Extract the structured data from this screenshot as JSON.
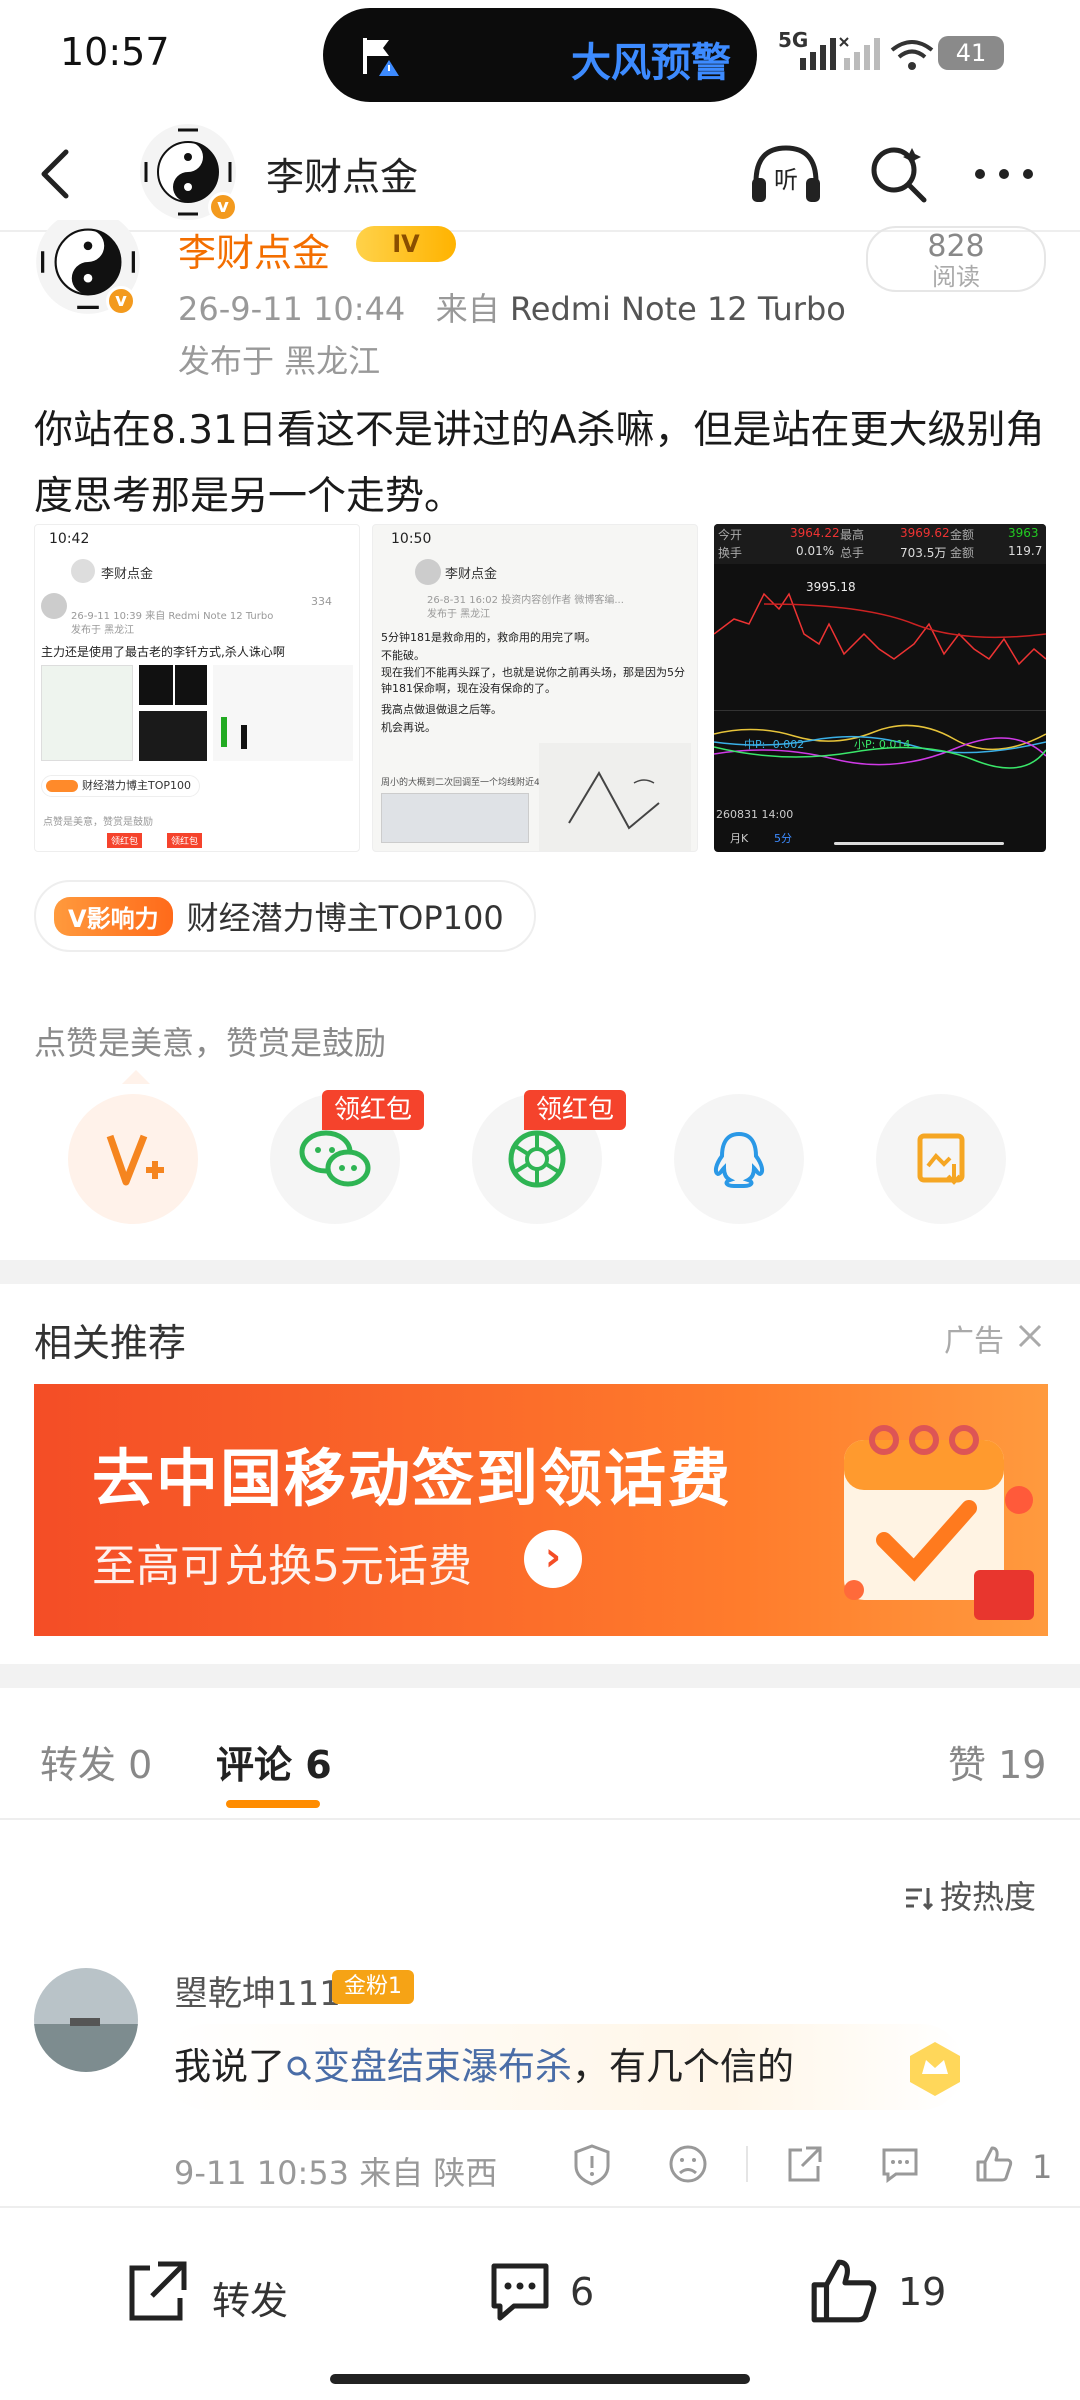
{
  "status_bar": {
    "time": "10:57",
    "alert": "大风预警",
    "network": "5G",
    "battery": "41"
  },
  "header": {
    "account_name": "李财点金"
  },
  "post": {
    "author": "李财点金",
    "level": "IV",
    "date": "26-9-11 10:44",
    "from_label": "来自",
    "device": "Redmi Note 12 Turbo",
    "location": "发布于 黑龙江",
    "read_count": "828",
    "read_label": "阅读",
    "text": "你站在8.31日看这不是讲过的A杀嘛，但是站在更大级别角度思考那是另一个走势。"
  },
  "thumb1": {
    "time": "10:42",
    "name": "李财点金",
    "meta": "26-9-11 10:39  来自 Redmi Note 12 Turbo",
    "location": "发布于 黑龙江",
    "reads": "334",
    "text": "主力还是使用了最古老的李钎方式,杀人诛心啊",
    "badge": "财经潜力博主TOP100",
    "sub": "点赞是美意，赞赏是鼓励",
    "red": "领红包"
  },
  "thumb2": {
    "time": "10:50",
    "name": "李财点金",
    "meta": "26-8-31 16:02  投资内容创作者 微博客编...",
    "location": "发布于 黑龙江",
    "line1": "5分钟181是救命用的，救命用的用完了啊。",
    "line2": "不能破。",
    "line3": "现在我们不能再头踩了，也就是说你之前再头场，那是因为5分钟181保命啊，现在没有保命的了。",
    "line4": "我高点做退做退之后等。",
    "line5": "机会再说。",
    "line6": "周小的大概到二次回调至一个均线附近4年。"
  },
  "thumb3": {
    "h1": "今开",
    "v1": "3964.22",
    "h2": "最高",
    "v2": "3969.62",
    "h3": "金额",
    "v3": "3963",
    "h4": "换手",
    "v4": "0.01%",
    "h5": "总手",
    "v5": "703.5万",
    "h6": "金额",
    "v6": "119.7",
    "price": "3995.18",
    "ind1": "中P: -0.002",
    "ind2": "小P: 0.014",
    "date": "260831 14:00",
    "tab1": "月K",
    "tab2": "5分"
  },
  "influence": {
    "tag": "V影响力",
    "text": "财经潜力博主TOP100"
  },
  "reward": {
    "label": "点赞是美意，赞赏是鼓励",
    "red_packet": "领红包"
  },
  "related": {
    "title": "相关推荐",
    "ad_label": "广告"
  },
  "banner": {
    "title": "去中国移动签到领话费",
    "subtitle": "至高可兑换5元话费"
  },
  "tabs": {
    "repost_label": "转发",
    "repost_count": "0",
    "comment_label": "评论",
    "comment_count": "6",
    "like_label": "赞",
    "like_count": "19"
  },
  "sort": {
    "label": "按热度"
  },
  "comment": {
    "user": "曌乾坤111",
    "badge": "金粉1",
    "text_before": "我说了",
    "topic": "变盘结束瀑布杀",
    "text_after": "，有几个信的",
    "time": "9-11 10:53",
    "from_label": "来自",
    "location": "陕西",
    "like_count": "1"
  },
  "bottom_bar": {
    "repost_label": "转发",
    "comment_count": "6",
    "like_count": "19"
  },
  "colors": {
    "accent": "#ff8c00",
    "author_orange": "#f36e00",
    "red_tag": "#f5432c",
    "topic_blue": "#4a6da7"
  }
}
